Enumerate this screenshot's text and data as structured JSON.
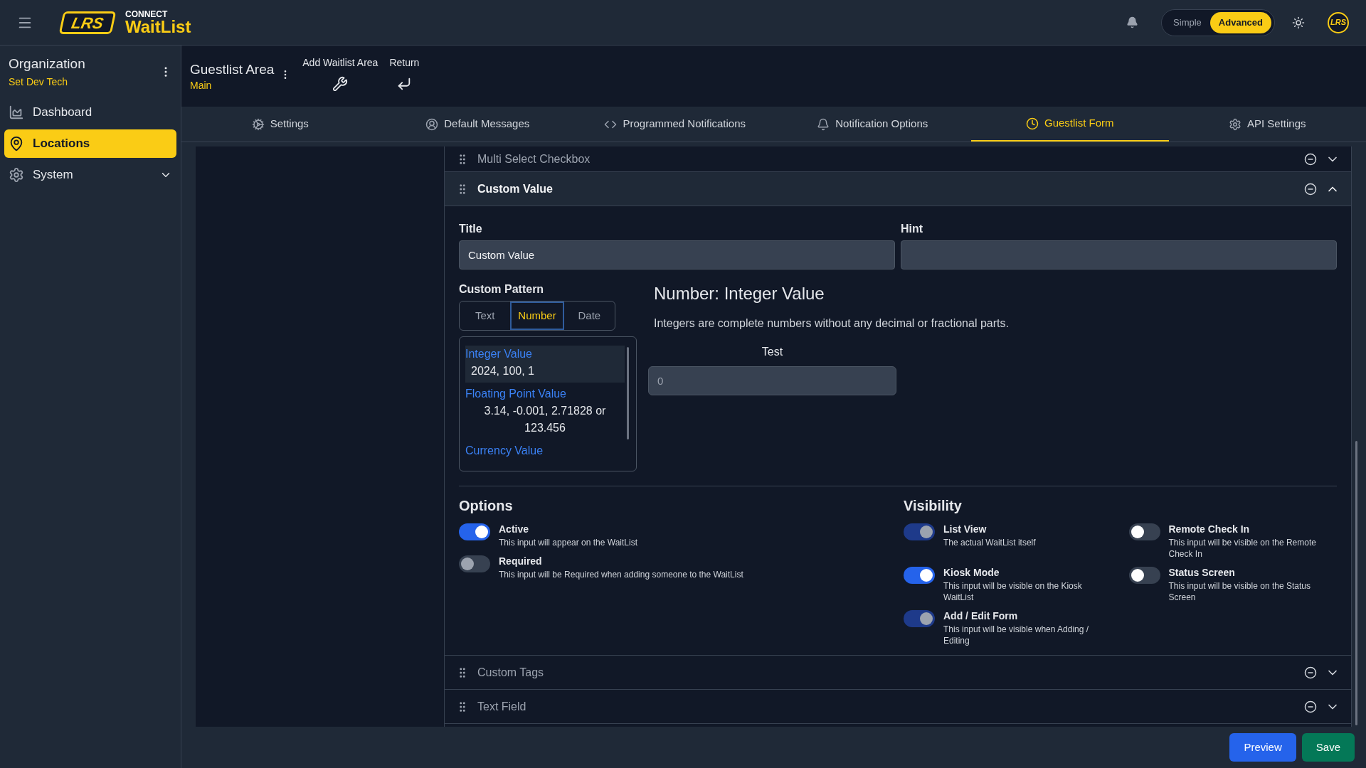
{
  "brand": {
    "logo": "LRS",
    "kicker": "CONNECT",
    "name": "WaitList"
  },
  "mode_switch": [
    {
      "label": "Simple",
      "selected": false
    },
    {
      "label": "Advanced",
      "selected": true
    }
  ],
  "avatar": "LRS",
  "sidebar": {
    "org_title": "Organization",
    "org_name": "Set Dev Tech",
    "items": [
      {
        "label": "Dashboard",
        "selected": false
      },
      {
        "label": "Locations",
        "selected": true
      },
      {
        "label": "System",
        "selected": false,
        "expanded": false
      }
    ]
  },
  "area": {
    "title": "Guestlist Area",
    "subtitle": "Main",
    "actions": [
      {
        "label": "Add Waitlist Area"
      },
      {
        "label": "Return"
      }
    ]
  },
  "tabs": [
    {
      "label": "Settings",
      "selected": false
    },
    {
      "label": "Default Messages",
      "selected": false
    },
    {
      "label": "Programmed Notifications",
      "selected": false
    },
    {
      "label": "Notification Options",
      "selected": false
    },
    {
      "label": "Guestlist Form",
      "selected": true
    },
    {
      "label": "API Settings",
      "selected": false
    }
  ],
  "form_items": [
    {
      "title": "Multi Select Checkbox",
      "expanded": false
    },
    {
      "title": "Custom Value",
      "expanded": true
    },
    {
      "title": "Custom Tags",
      "expanded": false
    },
    {
      "title": "Text Field",
      "expanded": false
    }
  ],
  "editor": {
    "title_field": {
      "label": "Title",
      "value": "Custom Value"
    },
    "hint_field": {
      "label": "Hint"
    },
    "pattern": {
      "label": "Custom Pattern",
      "types": [
        {
          "label": "Text",
          "selected": false
        },
        {
          "label": "Number",
          "selected": true
        },
        {
          "label": "Date",
          "selected": false
        }
      ],
      "options": [
        {
          "name": "Integer Value",
          "example": "2024, 100, 1",
          "selected": true
        },
        {
          "name": "Floating Point Value",
          "example": "3.14, -0.001, 2.71828 or 123.456",
          "selected": false
        },
        {
          "name": "Currency Value",
          "selected": false
        }
      ]
    },
    "detail": {
      "heading": "Number: Integer Value",
      "description": "Integers are complete numbers without any decimal or fractional parts.",
      "test_label": "Test",
      "test_placeholder": "0"
    },
    "options": {
      "title": "Options",
      "toggles": [
        {
          "label": "Active",
          "description": "This input will appear on the WaitList",
          "on": true,
          "disabled": false
        },
        {
          "label": "Required",
          "description": "This input will be Required when adding someone to the WaitList",
          "on": false,
          "disabled": true
        }
      ]
    },
    "visibility": {
      "title": "Visibility",
      "toggles": [
        {
          "label": "List View",
          "description": "The actual WaitList itself",
          "on": true,
          "disabled": true
        },
        {
          "label": "Remote Check In",
          "description": "This input will be visible on the Remote Check In",
          "on": false,
          "disabled": false
        },
        {
          "label": "Kiosk Mode",
          "description": "This input will be visible on the Kiosk WaitList",
          "on": true,
          "disabled": false
        },
        {
          "label": "Status Screen",
          "description": "This input will be visible on the Status Screen",
          "on": false,
          "disabled": false
        },
        {
          "label": "Add / Edit Form",
          "description": "This input will be visible when Adding / Editing",
          "on": true,
          "disabled": true
        }
      ]
    }
  },
  "footer_buttons": [
    {
      "label": "Preview",
      "kind": "primary"
    },
    {
      "label": "Save",
      "kind": "success"
    }
  ]
}
